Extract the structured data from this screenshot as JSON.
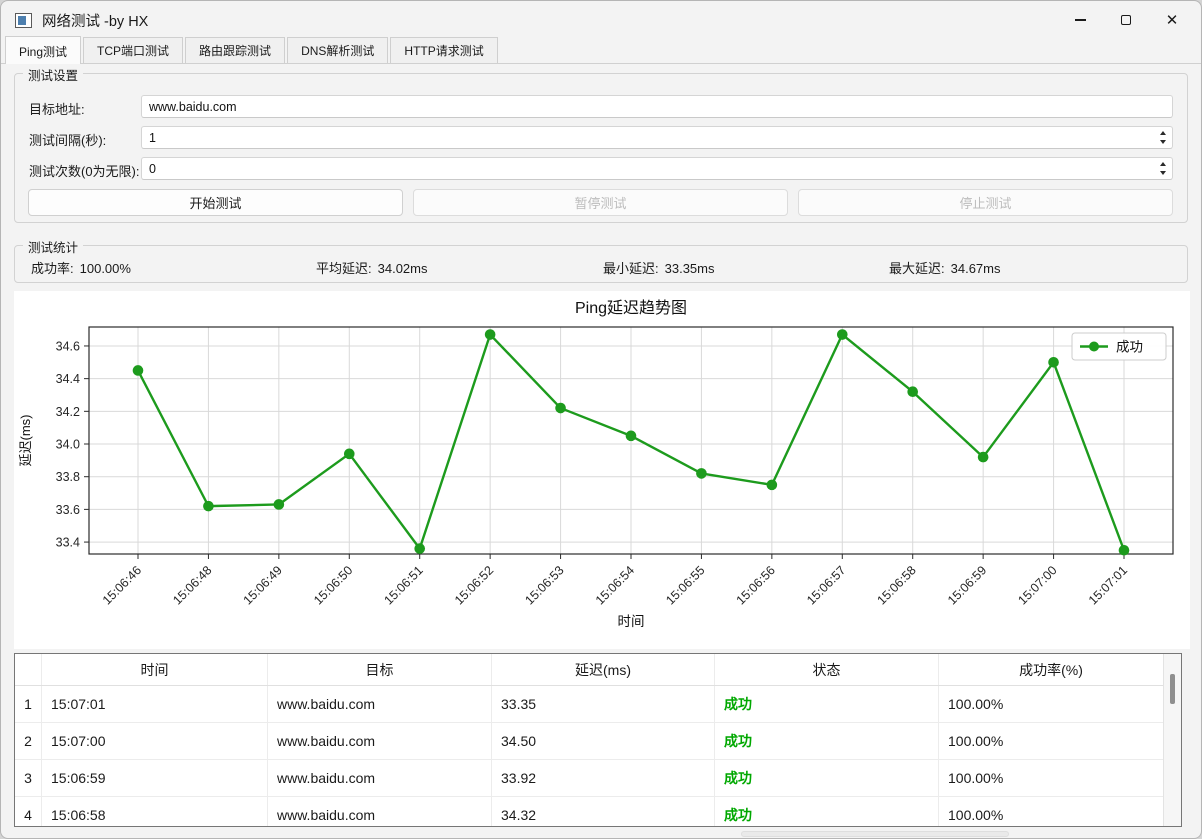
{
  "window": {
    "title": "网络测试 -by HX"
  },
  "tabs": [
    {
      "label": "Ping测试",
      "active": true
    },
    {
      "label": "TCP端口测试",
      "active": false
    },
    {
      "label": "路由跟踪测试",
      "active": false
    },
    {
      "label": "DNS解析测试",
      "active": false
    },
    {
      "label": "HTTP请求测试",
      "active": false
    }
  ],
  "settings": {
    "group_title": "测试设置",
    "fields": [
      {
        "label": "目标地址:",
        "value": "www.baidu.com"
      },
      {
        "label": "测试间隔(秒):",
        "value": "1"
      },
      {
        "label": "测试次数(0为无限):",
        "value": "0"
      }
    ],
    "buttons": [
      {
        "label": "开始测试",
        "enabled": true
      },
      {
        "label": "暂停测试",
        "enabled": false
      },
      {
        "label": "停止测试",
        "enabled": false
      }
    ]
  },
  "stats": {
    "group_title": "测试统计",
    "items": [
      {
        "label": "成功率:",
        "value": "100.00%"
      },
      {
        "label": "平均延迟:",
        "value": "34.02ms"
      },
      {
        "label": "最小延迟:",
        "value": "33.35ms"
      },
      {
        "label": "最大延迟:",
        "value": "34.67ms"
      }
    ]
  },
  "chart_data": {
    "type": "line",
    "title": "Ping延迟趋势图",
    "xlabel": "时间",
    "ylabel": "延迟(ms)",
    "x": [
      "15:06:46",
      "15:06:48",
      "15:06:49",
      "15:06:50",
      "15:06:51",
      "15:06:52",
      "15:06:53",
      "15:06:54",
      "15:06:55",
      "15:06:56",
      "15:06:57",
      "15:06:58",
      "15:06:59",
      "15:07:00",
      "15:07:01"
    ],
    "series": [
      {
        "name": "成功",
        "color": "#1d9b1d",
        "values": [
          34.45,
          33.62,
          33.63,
          33.94,
          33.36,
          34.67,
          34.22,
          34.05,
          33.82,
          33.75,
          34.67,
          34.32,
          33.92,
          34.5,
          33.35
        ]
      }
    ],
    "ylim": [
      33.327,
      34.716
    ],
    "yticks": [
      33.4,
      33.6,
      33.8,
      34.0,
      34.2,
      34.4,
      34.6
    ],
    "grid": true,
    "legend_position": "top-right"
  },
  "table": {
    "headers": [
      "时间",
      "目标",
      "延迟(ms)",
      "状态",
      "成功率(%)"
    ],
    "status_color": "#00a800",
    "rows": [
      {
        "num": "1",
        "time": "15:07:01",
        "target": "www.baidu.com",
        "latency": "33.35",
        "status": "成功",
        "rate": "100.00%"
      },
      {
        "num": "2",
        "time": "15:07:00",
        "target": "www.baidu.com",
        "latency": "34.50",
        "status": "成功",
        "rate": "100.00%"
      },
      {
        "num": "3",
        "time": "15:06:59",
        "target": "www.baidu.com",
        "latency": "33.92",
        "status": "成功",
        "rate": "100.00%"
      },
      {
        "num": "4",
        "time": "15:06:58",
        "target": "www.baidu.com",
        "latency": "34.32",
        "status": "成功",
        "rate": "100.00%"
      }
    ]
  }
}
